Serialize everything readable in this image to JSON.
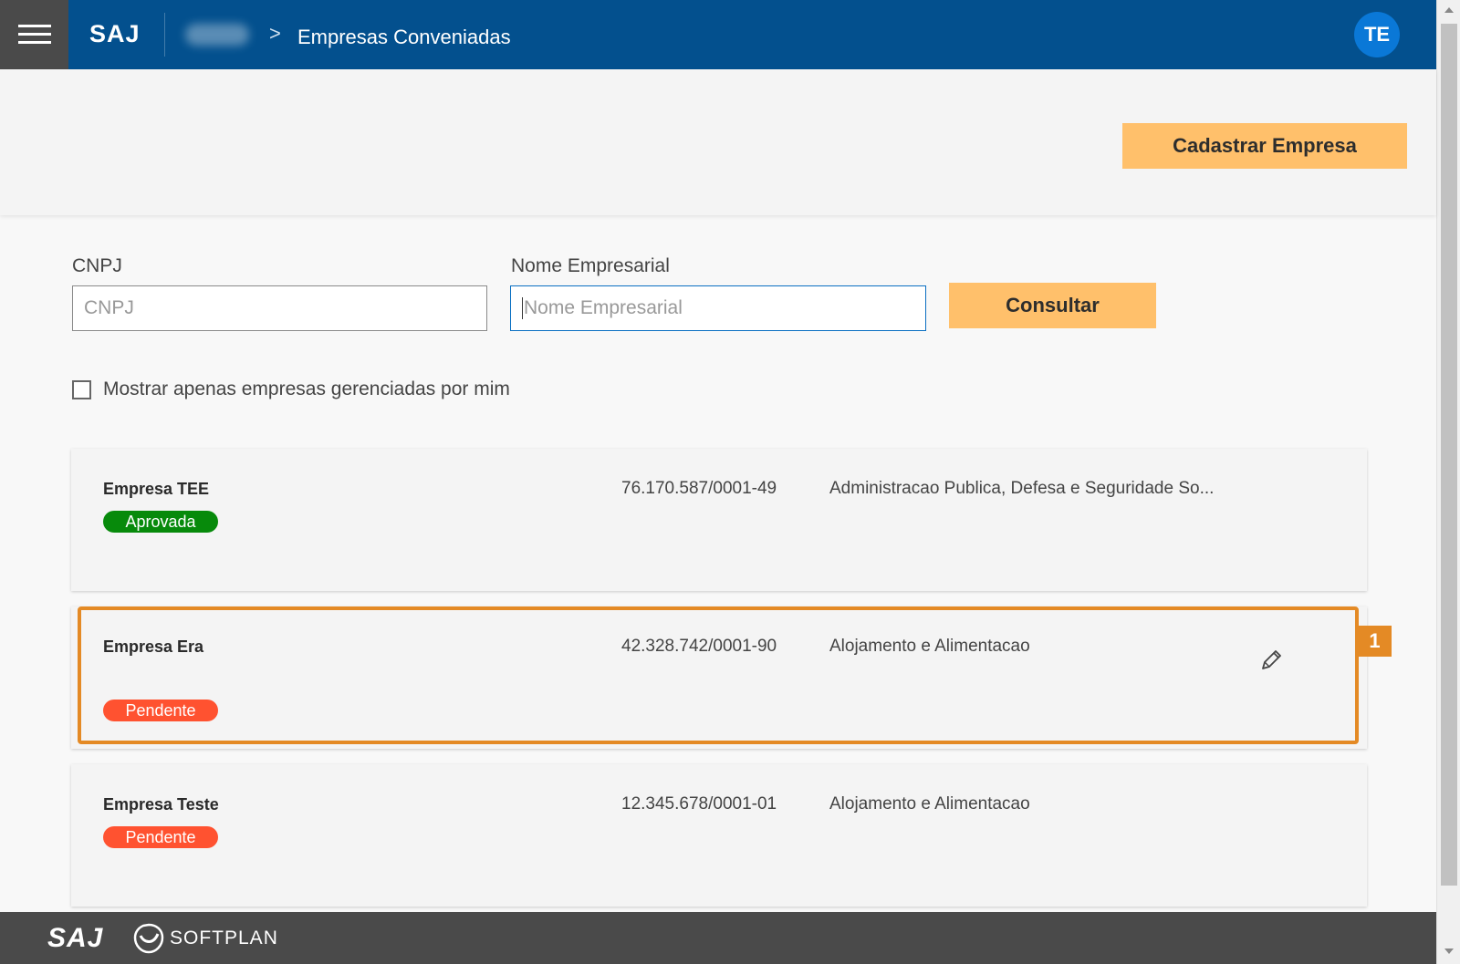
{
  "header": {
    "brand": "SAJ",
    "breadcrumb_current": "Empresas Conveniadas",
    "breadcrumb_separator": ">",
    "avatar_initials": "TE",
    "color": "#03508e"
  },
  "actions": {
    "register_label": "Cadastrar Empresa"
  },
  "filters": {
    "cnpj_label": "CNPJ",
    "cnpj_placeholder": "CNPJ",
    "cnpj_value": "",
    "name_label": "Nome Empresarial",
    "name_placeholder": "Nome Empresarial",
    "name_value": "",
    "search_label": "Consultar",
    "only_mine_label": "Mostrar apenas empresas gerenciadas por mim",
    "only_mine_checked": false
  },
  "companies": [
    {
      "name": "Empresa TEE",
      "cnpj": "76.170.587/0001-49",
      "activity": "Administracao Publica, Defesa e Seguridade So...",
      "status": "Aprovada",
      "status_color": "#078a0b"
    },
    {
      "name": "Empresa Era",
      "cnpj": "42.328.742/0001-90",
      "activity": "Alojamento e Alimentacao",
      "status": "Pendente",
      "status_color": "#ff5230",
      "edit_icon": "pencil-icon"
    },
    {
      "name": "Empresa Teste",
      "cnpj": "12.345.678/0001-01",
      "activity": "Alojamento e Alimentacao",
      "status": "Pendente",
      "status_color": "#ff5230"
    }
  ],
  "annotation": {
    "step": "1",
    "color": "#e48a25"
  },
  "footer": {
    "brand": "SAJ",
    "company": "SOFTPLAN"
  },
  "accent_color": "#ffc06b"
}
